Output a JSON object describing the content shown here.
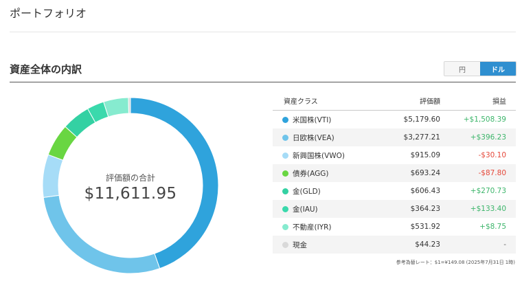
{
  "page": {
    "title": "ポートフォリオ"
  },
  "section": {
    "title": "資産全体の内訳",
    "toggle": {
      "yen_label": "円",
      "dollar_label": "ドル",
      "selected": "ドル"
    }
  },
  "donut": {
    "center_label": "評価額の合計",
    "center_value": "$11,611.95"
  },
  "table": {
    "headers": {
      "asset_class": "資産クラス",
      "value": "評価額",
      "pl": "損益"
    },
    "rows": [
      {
        "name": "米国株(VTI)",
        "value": "$5,179.60",
        "pl": "+$1,508.39",
        "pl_sign": "pos",
        "color": "#2fa3dc",
        "amount": 5179.6
      },
      {
        "name": "日欧株(VEA)",
        "value": "$3,277.21",
        "pl": "+$396.23",
        "pl_sign": "pos",
        "color": "#6fc4ea",
        "amount": 3277.21
      },
      {
        "name": "新興国株(VWO)",
        "value": "$915.09",
        "pl": "-$30.10",
        "pl_sign": "neg",
        "color": "#a6dcf7",
        "amount": 915.09
      },
      {
        "name": "債券(AGG)",
        "value": "$693.24",
        "pl": "-$87.80",
        "pl_sign": "neg",
        "color": "#69d642",
        "amount": 693.24
      },
      {
        "name": "金(GLD)",
        "value": "$606.43",
        "pl": "+$270.73",
        "pl_sign": "pos",
        "color": "#34d1a3",
        "amount": 606.43
      },
      {
        "name": "金(IAU)",
        "value": "$364.23",
        "pl": "+$133.40",
        "pl_sign": "pos",
        "color": "#3ad9ac",
        "amount": 364.23
      },
      {
        "name": "不動産(IYR)",
        "value": "$531.92",
        "pl": "+$8.75",
        "pl_sign": "pos",
        "color": "#86ebcf",
        "amount": 531.92
      },
      {
        "name": "現金",
        "value": "$44.23",
        "pl": "-",
        "pl_sign": "neu",
        "color": "#d9d9d9",
        "amount": 44.23
      }
    ]
  },
  "fx_note": "参考為替レート：$1=¥149.08 (2025年7月31日 1時)"
}
